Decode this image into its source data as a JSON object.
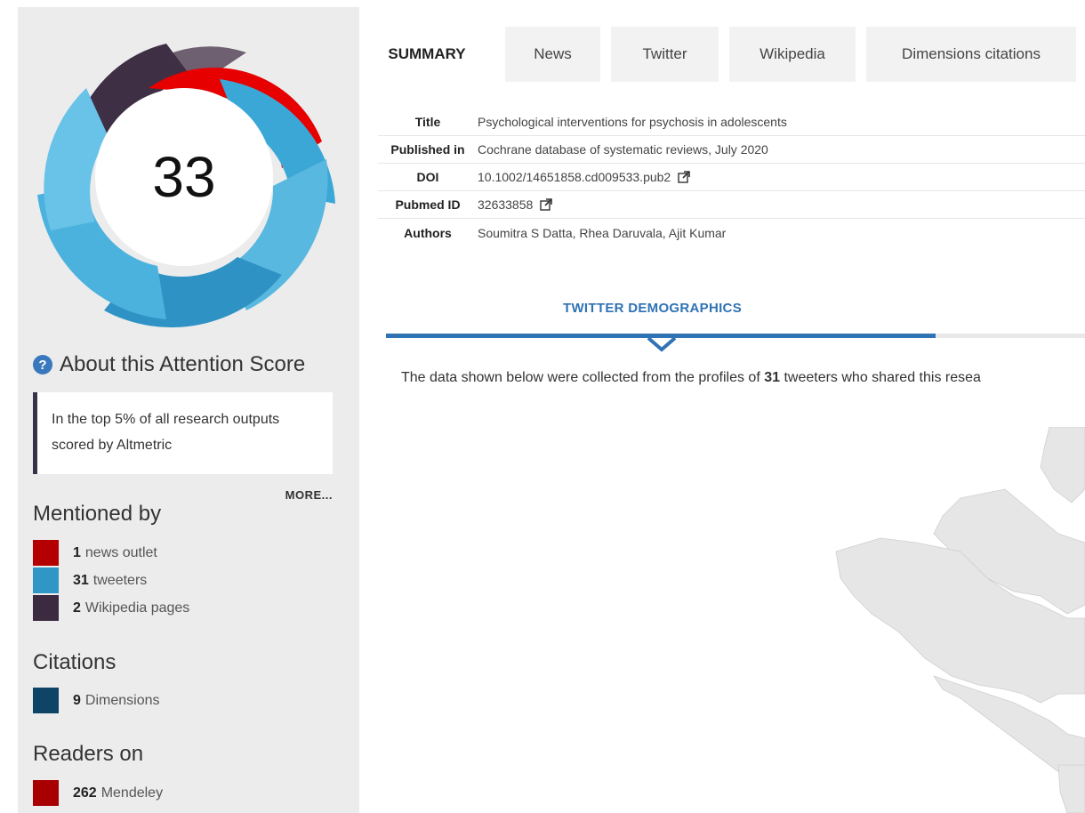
{
  "donut": {
    "score": "33",
    "colors": {
      "news": "#e60000",
      "twitter": "#2f9fd1",
      "wikipedia": "#3e2f45"
    }
  },
  "about": {
    "icon": "question-circle-icon",
    "label": "About this Attention Score"
  },
  "top_box": {
    "text": "In the top 5% of all research outputs scored by Altmetric"
  },
  "more_label": "MORE...",
  "mentioned_by": {
    "title": "Mentioned by",
    "items": [
      {
        "count": "1",
        "label": "news outlet",
        "color": "#b40000"
      },
      {
        "count": "31",
        "label": "tweeters",
        "color": "#2f96c6"
      },
      {
        "count": "2",
        "label": "Wikipedia pages",
        "color": "#3b2a40"
      }
    ]
  },
  "citations": {
    "title": "Citations",
    "items": [
      {
        "count": "9",
        "label": "Dimensions",
        "color": "#0e4466"
      }
    ]
  },
  "readers": {
    "title": "Readers on",
    "items": [
      {
        "count": "262",
        "label": "Mendeley",
        "color": "#a80000"
      }
    ]
  },
  "tabs": [
    {
      "label": "SUMMARY",
      "active": true
    },
    {
      "label": "News"
    },
    {
      "label": "Twitter"
    },
    {
      "label": "Wikipedia"
    },
    {
      "label": "Dimensions citations"
    }
  ],
  "summary": {
    "title_label": "Title",
    "title_value": "Psychological interventions for psychosis in adolescents",
    "published_label": "Published in",
    "published_value": "Cochrane database of systematic reviews, July 2020",
    "doi_label": "DOI",
    "doi_value": "10.1002/14651858.cd009533.pub2",
    "pubmed_label": "Pubmed ID",
    "pubmed_value": "32633858",
    "authors_label": "Authors",
    "authors_value": "Soumitra S Datta, Rhea Daruvala, Ajit Kumar"
  },
  "demographics": {
    "title": "TWITTER DEMOGRAPHICS",
    "desc_before": "The data shown below were collected from the profiles of ",
    "desc_count": "31",
    "desc_after": " tweeters who shared this resea"
  }
}
